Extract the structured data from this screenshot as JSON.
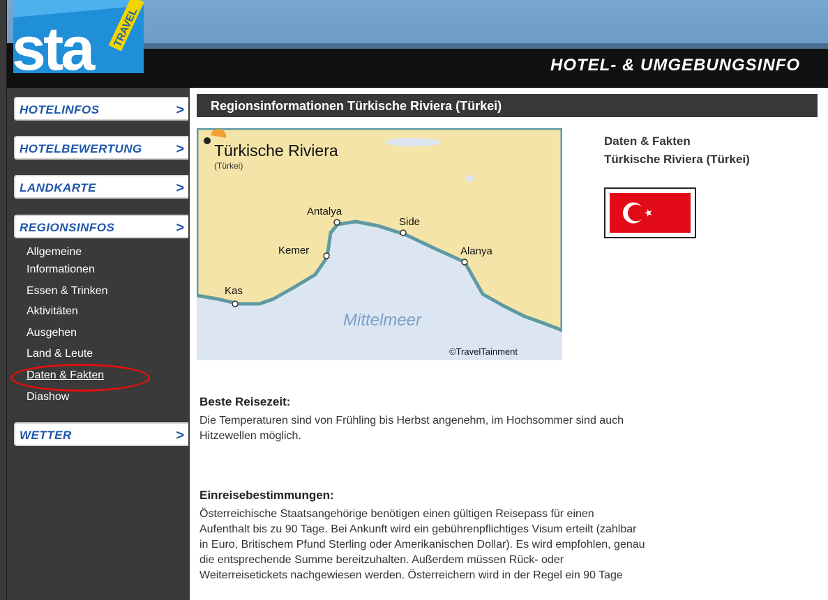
{
  "logo": {
    "brand": "sta",
    "tag": "TRAVEL"
  },
  "header": {
    "title": "HOTEL- & UMGEBUNGSINFO"
  },
  "nav": {
    "hotelinfos": "HOTELINFOS",
    "hotelbewertung": "HOTELBEWERTUNG",
    "landkarte": "LANDKARTE",
    "regionsinfos": "REGIONSINFOS",
    "wetter": "WETTER",
    "chevron": ">"
  },
  "subnav": [
    "Allgemeine",
    "Informationen",
    "Essen & Trinken",
    "Aktivitäten",
    "Ausgehen",
    "Land & Leute",
    "Daten & Fakten",
    "Diashow"
  ],
  "content": {
    "title": "Regionsinformationen Türkische Riviera (Türkei)"
  },
  "map": {
    "region": "Türkische Riviera",
    "country": "(Türkei)",
    "cities": [
      "Antalya",
      "Side",
      "Kemer",
      "Alanya",
      "Kas"
    ],
    "sea": "Mittelmeer",
    "copyright": "©TravelTainment",
    "colors": {
      "land": "#f5e4a8",
      "sea": "#dce6f3",
      "coast": "#5f9aa3"
    }
  },
  "facts": {
    "line1": "Daten & Fakten",
    "line2": "Türkische Riviera (Türkei)"
  },
  "flag": {
    "color": "#e30a17"
  },
  "sections": {
    "reisezeit": {
      "heading": "Beste Reisezeit:",
      "lines": [
        "Die Temperaturen sind von Frühling bis Herbst angenehm, im Hochsommer sind auch",
        "Hitzewellen möglich."
      ]
    },
    "einreise": {
      "heading": "Einreisebestimmungen:",
      "lines": [
        "Österreichische Staatsangehörige benötigen einen gültigen Reisepass für einen",
        "Aufenthalt bis zu 90 Tage. Bei Ankunft wird ein gebührenpflichtiges Visum erteilt (zahlbar",
        "in Euro, Britischem Pfund Sterling oder Amerikanischen Dollar). Es wird empfohlen, genau",
        "die entsprechende Summe bereitzuhalten. Außerdem müssen Rück- oder",
        "Weiterreisetickets nachgewiesen werden. Österreichern wird in der Regel ein 90 Tage"
      ]
    }
  }
}
